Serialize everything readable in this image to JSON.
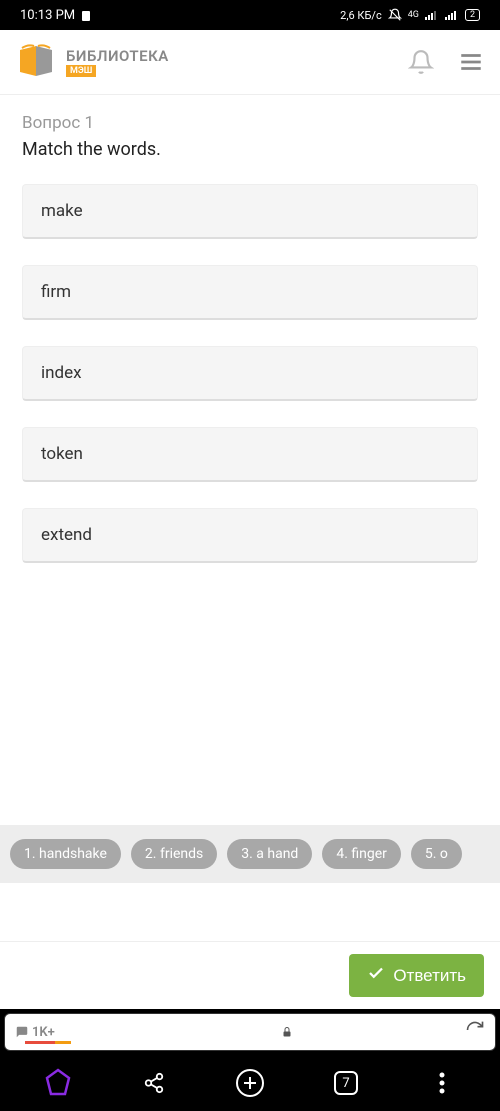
{
  "status": {
    "time": "10:13 PM",
    "data_rate": "2,6 КБ/с",
    "network": "4G",
    "battery": "2"
  },
  "header": {
    "brand_title": "БИБЛИОТЕКА",
    "brand_badge": "МЭШ"
  },
  "question": {
    "number": "Вопрос 1",
    "text": "Match the words.",
    "options": [
      "make",
      "firm",
      "index",
      "token",
      "extend"
    ],
    "chips": [
      "1. handshake",
      "2. friends",
      "3. a hand",
      "4. finger",
      "5. o"
    ]
  },
  "submit": {
    "label": "Ответить"
  },
  "browser": {
    "comments": "1K+",
    "tab_count": "7"
  }
}
